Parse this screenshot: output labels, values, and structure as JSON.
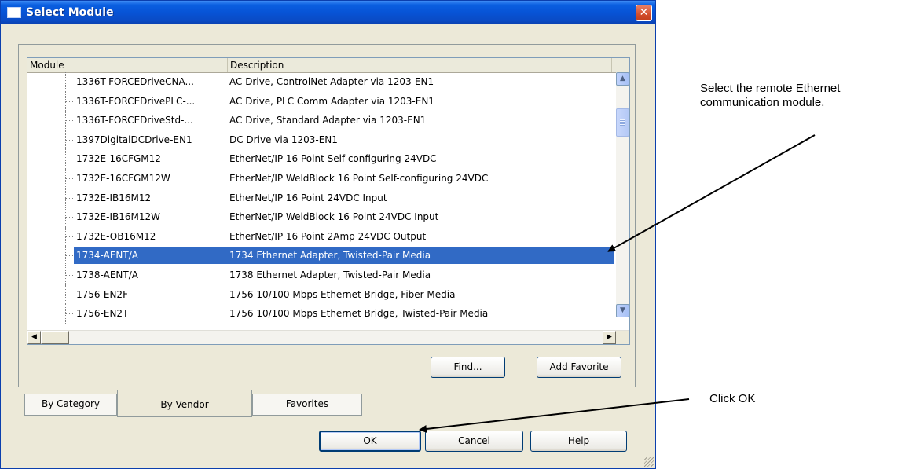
{
  "window": {
    "title": "Select Module",
    "close_glyph": "✕"
  },
  "list": {
    "columns": [
      "Module",
      "Description"
    ],
    "rows": [
      {
        "module": "1336T-FORCEDriveCNA...",
        "description": "AC Drive, ControlNet Adapter via 1203-EN1",
        "selected": false
      },
      {
        "module": "1336T-FORCEDrivePLC-...",
        "description": "AC Drive, PLC Comm Adapter via 1203-EN1",
        "selected": false
      },
      {
        "module": "1336T-FORCEDriveStd-...",
        "description": "AC Drive, Standard Adapter via 1203-EN1",
        "selected": false
      },
      {
        "module": "1397DigitalDCDrive-EN1",
        "description": "DC Drive via 1203-EN1",
        "selected": false
      },
      {
        "module": "1732E-16CFGM12",
        "description": "EtherNet/IP 16 Point Self-configuring 24VDC",
        "selected": false
      },
      {
        "module": "1732E-16CFGM12W",
        "description": "EtherNet/IP WeldBlock 16 Point Self-configuring 24VDC",
        "selected": false
      },
      {
        "module": "1732E-IB16M12",
        "description": "EtherNet/IP 16 Point 24VDC Input",
        "selected": false
      },
      {
        "module": "1732E-IB16M12W",
        "description": "EtherNet/IP WeldBlock 16 Point 24VDC Input",
        "selected": false
      },
      {
        "module": "1732E-OB16M12",
        "description": "EtherNet/IP 16 Point 2Amp 24VDC Output",
        "selected": false
      },
      {
        "module": "1734-AENT/A",
        "description": "1734 Ethernet Adapter, Twisted-Pair Media",
        "selected": true
      },
      {
        "module": "1738-AENT/A",
        "description": "1738 Ethernet Adapter, Twisted-Pair Media",
        "selected": false
      },
      {
        "module": "1756-EN2F",
        "description": "1756 10/100 Mbps Ethernet Bridge, Fiber Media",
        "selected": false
      },
      {
        "module": "1756-EN2T",
        "description": "1756 10/100 Mbps Ethernet Bridge, Twisted-Pair Media",
        "selected": false
      }
    ]
  },
  "buttons": {
    "find": "Find...",
    "add_favorite": "Add Favorite",
    "ok": "OK",
    "cancel": "Cancel",
    "help": "Help"
  },
  "tabs": {
    "by_category": "By Category",
    "by_vendor": "By Vendor",
    "favorites": "Favorites"
  },
  "annotations": {
    "select_line1": "Select the remote Ethernet",
    "select_line2": "communication module.",
    "click_ok": "Click OK"
  },
  "colors": {
    "title_bar": "#0753d6",
    "selection": "#316ac5",
    "dialog_bg": "#ece9d8"
  }
}
